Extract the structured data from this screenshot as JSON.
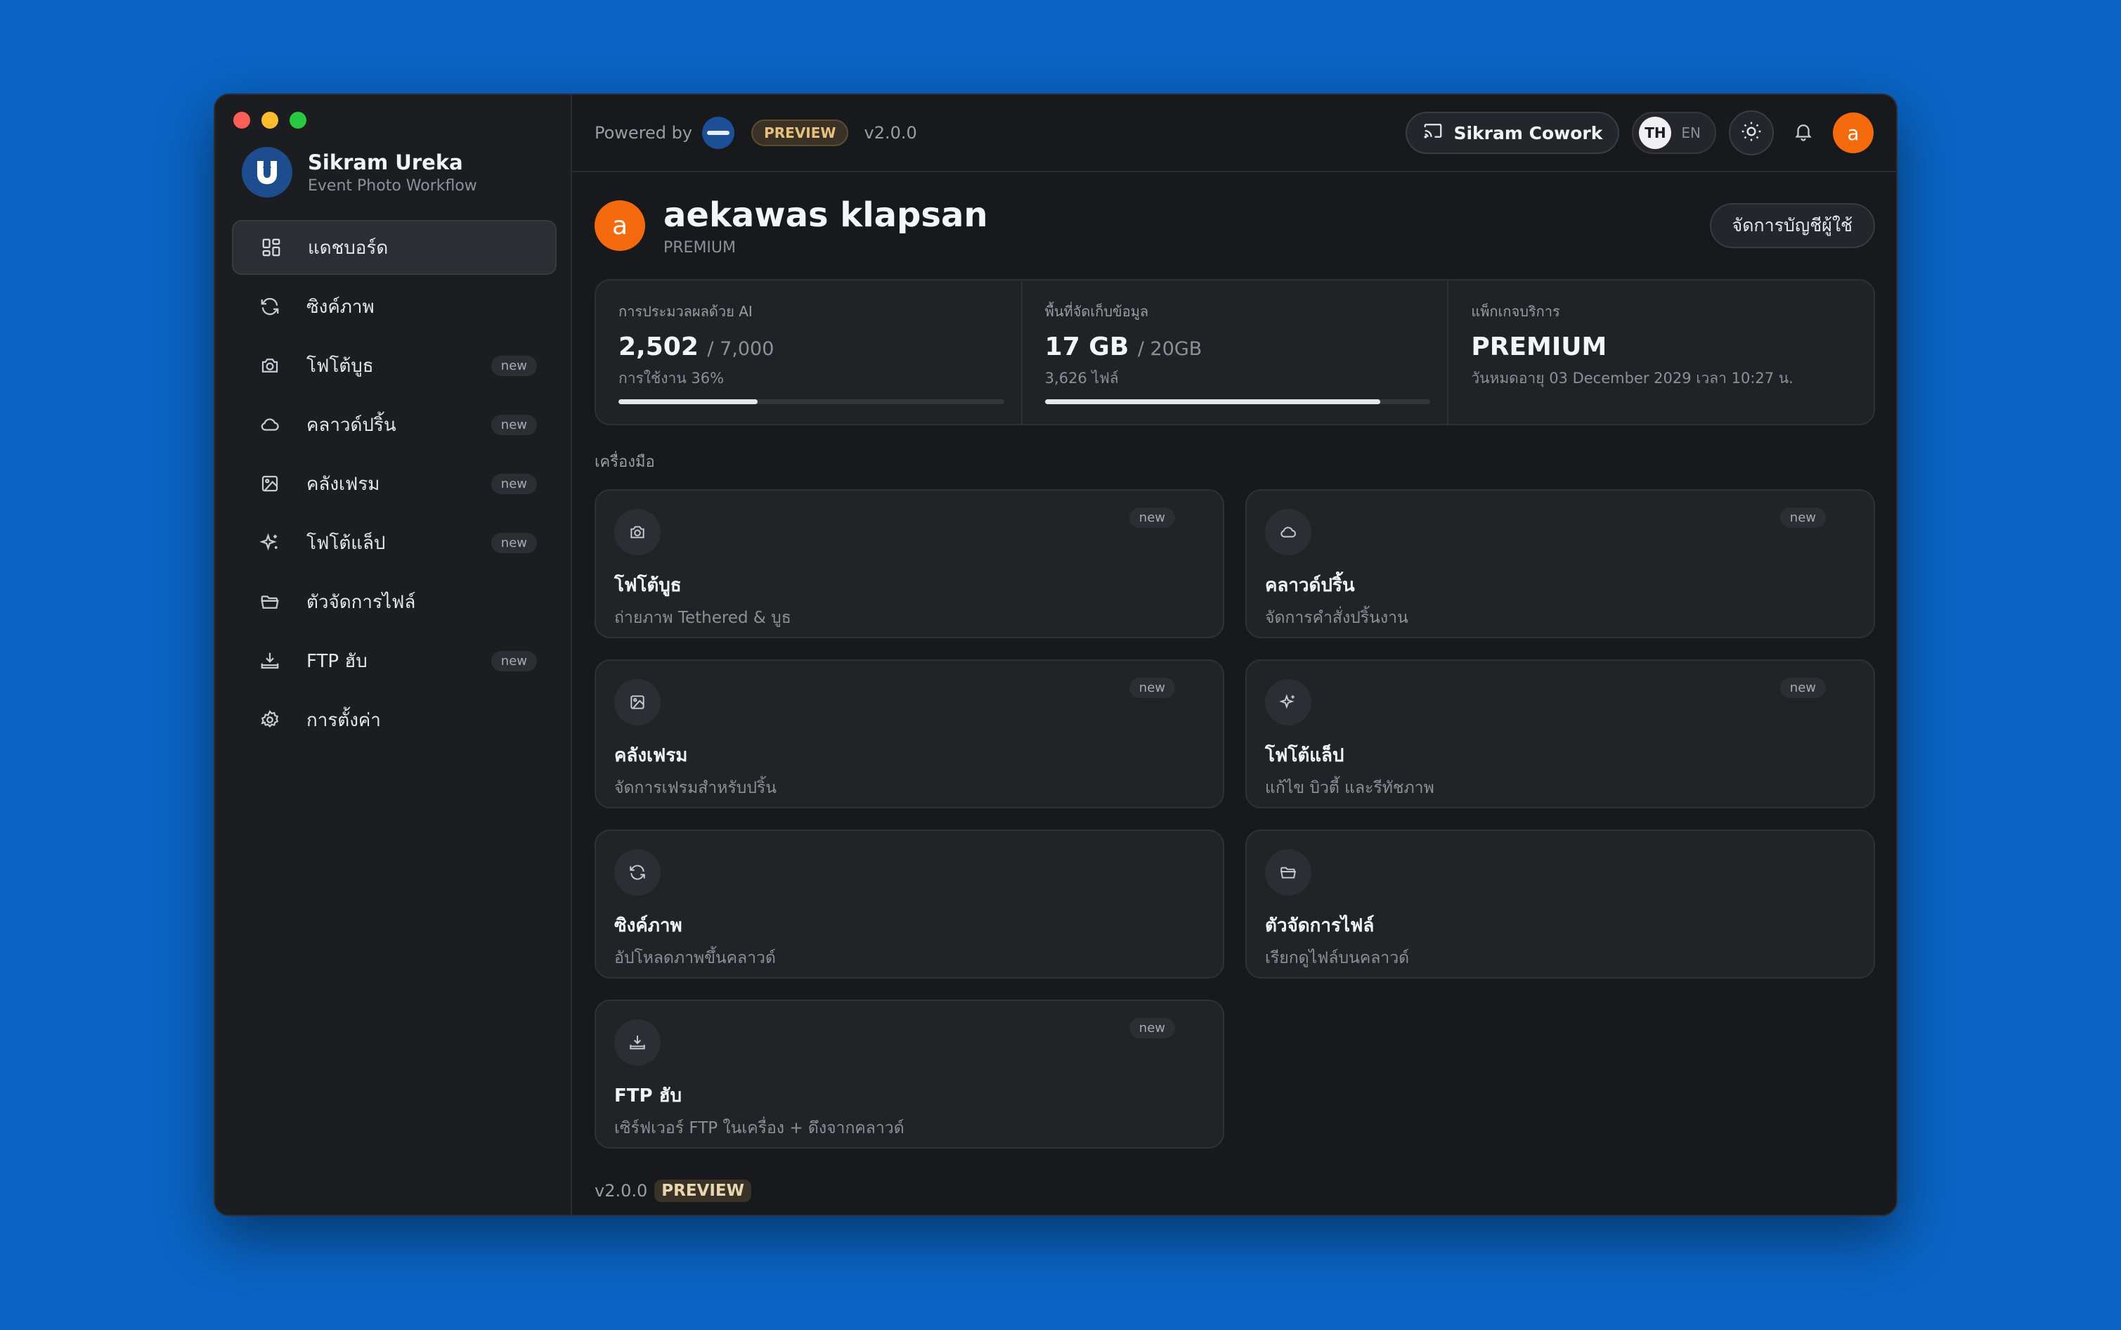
{
  "app": {
    "name": "Sikram Ureka",
    "subtitle": "Event Photo Workflow"
  },
  "sidebar": {
    "items": [
      {
        "label": "แดชบอร์ด",
        "icon": "dashboard-icon",
        "active": true,
        "new": false
      },
      {
        "label": "ซิงค์ภาพ",
        "icon": "sync-icon",
        "active": false,
        "new": false
      },
      {
        "label": "โฟโต้บูธ",
        "icon": "camera-icon",
        "active": false,
        "new": true
      },
      {
        "label": "คลาวด์ปริ้น",
        "icon": "cloud-icon",
        "active": false,
        "new": true
      },
      {
        "label": "คลังเฟรม",
        "icon": "image-icon",
        "active": false,
        "new": true
      },
      {
        "label": "โฟโต้แล็ป",
        "icon": "sparkle-icon",
        "active": false,
        "new": true
      },
      {
        "label": "ตัวจัดการไฟล์",
        "icon": "folder-icon",
        "active": false,
        "new": false
      },
      {
        "label": "FTP ฮับ",
        "icon": "download-tray-icon",
        "active": false,
        "new": true
      },
      {
        "label": "การตั้งค่า",
        "icon": "gear-icon",
        "active": false,
        "new": false
      }
    ],
    "new_label": "new"
  },
  "topbar": {
    "powered_by": "Powered by",
    "preview": "PREVIEW",
    "version": "v2.0.0",
    "cowork_label": "Sikram Cowork",
    "lang_active": "TH",
    "lang_inactive": "EN"
  },
  "profile": {
    "avatar_letter": "a",
    "name": "aekawas klapsan",
    "tier": "PREMIUM",
    "manage_label": "จัดการบัญชีผู้ใช้"
  },
  "stats": [
    {
      "label": "การประมวลผลด้วย AI",
      "value": "2,502",
      "total": "/ 7,000",
      "sub": "การใช้งาน 36%",
      "progress": 0.36
    },
    {
      "label": "พื้นที่จัดเก็บข้อมูล",
      "value": "17 GB",
      "total": "/ 20GB",
      "sub": "3,626 ไฟล์",
      "progress": 0.87
    },
    {
      "label": "แพ็กเกจบริการ",
      "value": "PREMIUM",
      "total": "",
      "sub": "วันหมดอายุ 03 December 2029 เวลา 10:27 น.",
      "progress": null
    }
  ],
  "tools_section": "เครื่องมือ",
  "tools": [
    {
      "title": "โฟโต้บูธ",
      "desc": "ถ่ายภาพ Tethered & บูธ",
      "icon": "camera-icon",
      "new": true
    },
    {
      "title": "คลาวด์ปริ้น",
      "desc": "จัดการคำสั่งปริ้นงาน",
      "icon": "cloud-icon",
      "new": true
    },
    {
      "title": "คลังเฟรม",
      "desc": "จัดการเฟรมสำหรับปริ้น",
      "icon": "image-icon",
      "new": true
    },
    {
      "title": "โฟโต้แล็ป",
      "desc": "แก้ไข บิวตี้ และรีทัชภาพ",
      "icon": "sparkle-icon",
      "new": true
    },
    {
      "title": "ซิงค์ภาพ",
      "desc": "อัปโหลดภาพขึ้นคลาวด์",
      "icon": "sync-icon",
      "new": false
    },
    {
      "title": "ตัวจัดการไฟล์",
      "desc": "เรียกดูไฟล์บนคลาวด์",
      "icon": "folder-icon",
      "new": false
    },
    {
      "title": "FTP ฮับ",
      "desc": "เซิร์ฟเวอร์ FTP ในเครื่อง + ดึงจากคลาวด์",
      "icon": "download-tray-icon",
      "new": true
    }
  ],
  "footer": {
    "version": "v2.0.0",
    "preview": "PREVIEW"
  },
  "colors": {
    "accent_orange": "#f46a0c",
    "background_blue": "#0a64c4",
    "window_bg": "#18191c"
  }
}
